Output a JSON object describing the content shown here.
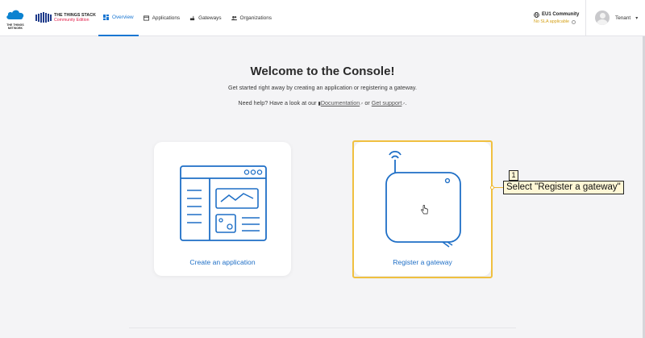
{
  "brand": {
    "network_logo_lines": [
      "THE THINGS",
      "NETWORK"
    ],
    "stack_name": "THE THINGS STACK",
    "edition": "Community Edition"
  },
  "nav": {
    "items": [
      {
        "label": "Overview",
        "icon": "overview-icon",
        "active": true
      },
      {
        "label": "Applications",
        "icon": "applications-icon",
        "active": false
      },
      {
        "label": "Gateways",
        "icon": "gateway-icon",
        "active": false
      },
      {
        "label": "Organizations",
        "icon": "organizations-icon",
        "active": false
      }
    ]
  },
  "cluster": {
    "name": "EU1 Community",
    "sla": "No SLA applicable"
  },
  "user": {
    "name": "Tenant"
  },
  "main": {
    "title": "Welcome to the Console!",
    "subtitle": "Get started right away by creating an application or registering a gateway.",
    "help_prefix": "Need help? Have a look at our",
    "documentation_link": "Documentation",
    "help_or": "or",
    "support_link": "Get support",
    "help_suffix": "."
  },
  "cards": {
    "create_application": "Create an application",
    "register_gateway": "Register a gateway"
  },
  "annotation": {
    "number": "1",
    "text": "Select \"Register a gateway\"",
    "color": "#f0c040"
  },
  "colors": {
    "accent": "#1976d2",
    "link_blue": "#1f6fc6",
    "edition_red": "#e11d48",
    "sla_yellow": "#d4a017"
  }
}
